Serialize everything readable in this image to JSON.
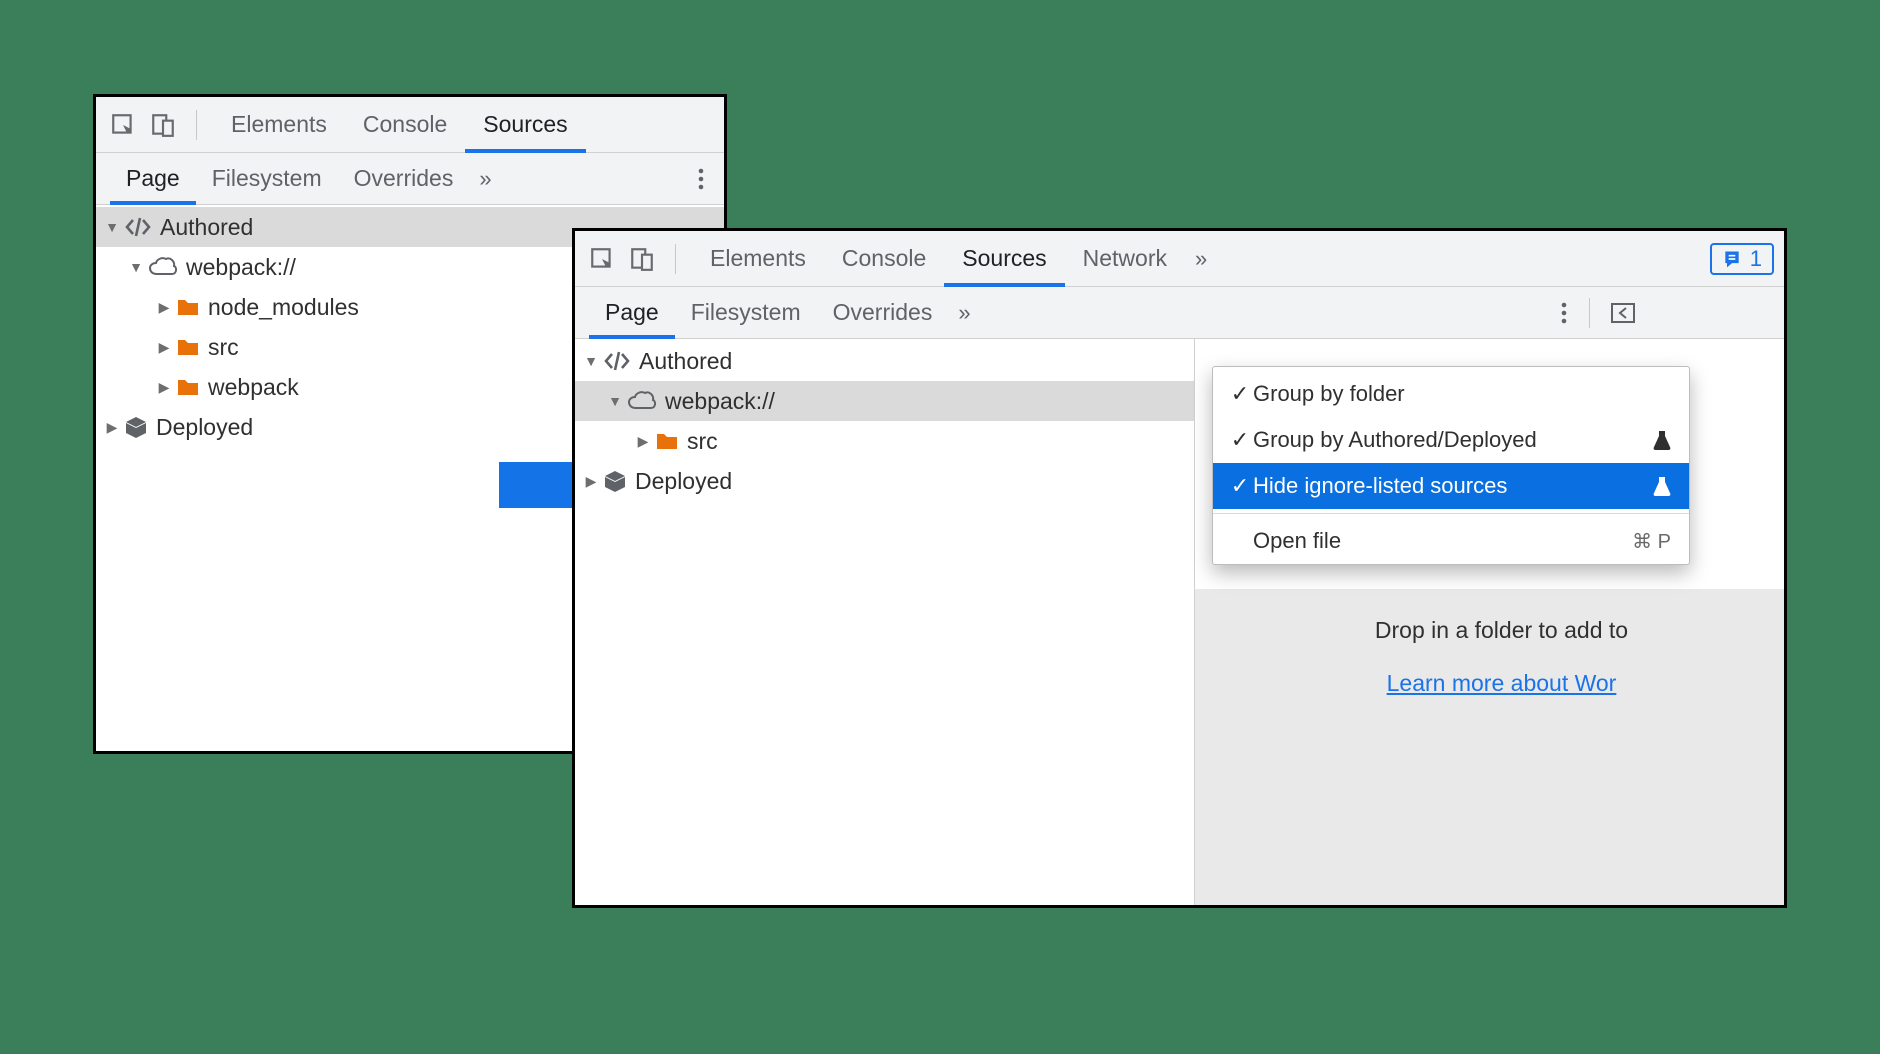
{
  "panel1": {
    "main_tabs": {
      "elements": "Elements",
      "console": "Console",
      "sources": "Sources"
    },
    "sub_tabs": {
      "page": "Page",
      "filesystem": "Filesystem",
      "overrides": "Overrides"
    },
    "tree": {
      "authored": "Authored",
      "webpack": "webpack://",
      "node_modules": "node_modules",
      "src": "src",
      "webpack_folder": "webpack",
      "deployed": "Deployed"
    }
  },
  "panel2": {
    "main_tabs": {
      "elements": "Elements",
      "console": "Console",
      "sources": "Sources",
      "network": "Network"
    },
    "issues_count": "1",
    "sub_tabs": {
      "page": "Page",
      "filesystem": "Filesystem",
      "overrides": "Overrides"
    },
    "tree": {
      "authored": "Authored",
      "webpack": "webpack://",
      "src": "src",
      "deployed": "Deployed"
    },
    "dropdown": {
      "group_by_folder": "Group by folder",
      "group_by_authored": "Group by Authored/Deployed",
      "hide_ignore": "Hide ignore-listed sources",
      "open_file": "Open file",
      "open_file_shortcut": "⌘ P"
    },
    "info": {
      "drop_text": "Drop in a folder to add to",
      "learn_more": "Learn more about Wor"
    }
  }
}
